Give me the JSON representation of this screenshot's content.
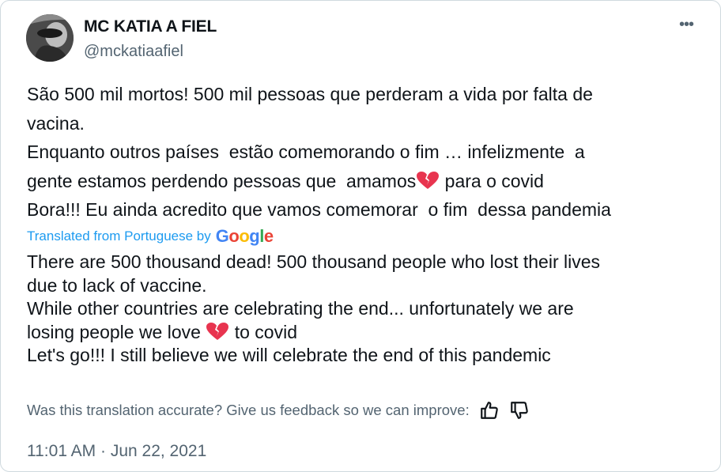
{
  "author": {
    "name": "MC KATIA A FIEL",
    "handle": "@mckatiaafiel"
  },
  "tweet": {
    "original_lines": [
      "São 500 mil mortos! 500 mil pessoas que perderam a vida por falta de",
      "vacina.",
      "Enquanto outros países  estão comemorando o fim … infelizmente  a",
      "gente estamos perdendo pessoas que  amamos",
      " para o covid",
      "Bora!!! Eu ainda acredito que vamos comemorar  o fim  dessa pandemia"
    ],
    "translated_from": "Translated from Portuguese by",
    "translator": "Google",
    "translation_lines": [
      "There are 500 thousand dead! 500 thousand people who lost their lives",
      "due to lack of vaccine.",
      "While other countries are celebrating the end... unfortunately we are",
      "losing people we love ",
      " to covid",
      "Let's go!!! I still believe we will celebrate the end of this pandemic"
    ],
    "emoji": "broken-heart-emoji"
  },
  "feedback": {
    "question": "Was this translation accurate? Give us feedback so we can improve:",
    "thumbs_up_icon": "thumbs-up-icon",
    "thumbs_down_icon": "thumbs-down-icon"
  },
  "timestamp": "11:01 AM · Jun 22, 2021",
  "more_icon": "more-options-icon",
  "colors": {
    "link": "#1d9bf0",
    "secondary_text": "#536471",
    "heart": "#e8344f"
  }
}
